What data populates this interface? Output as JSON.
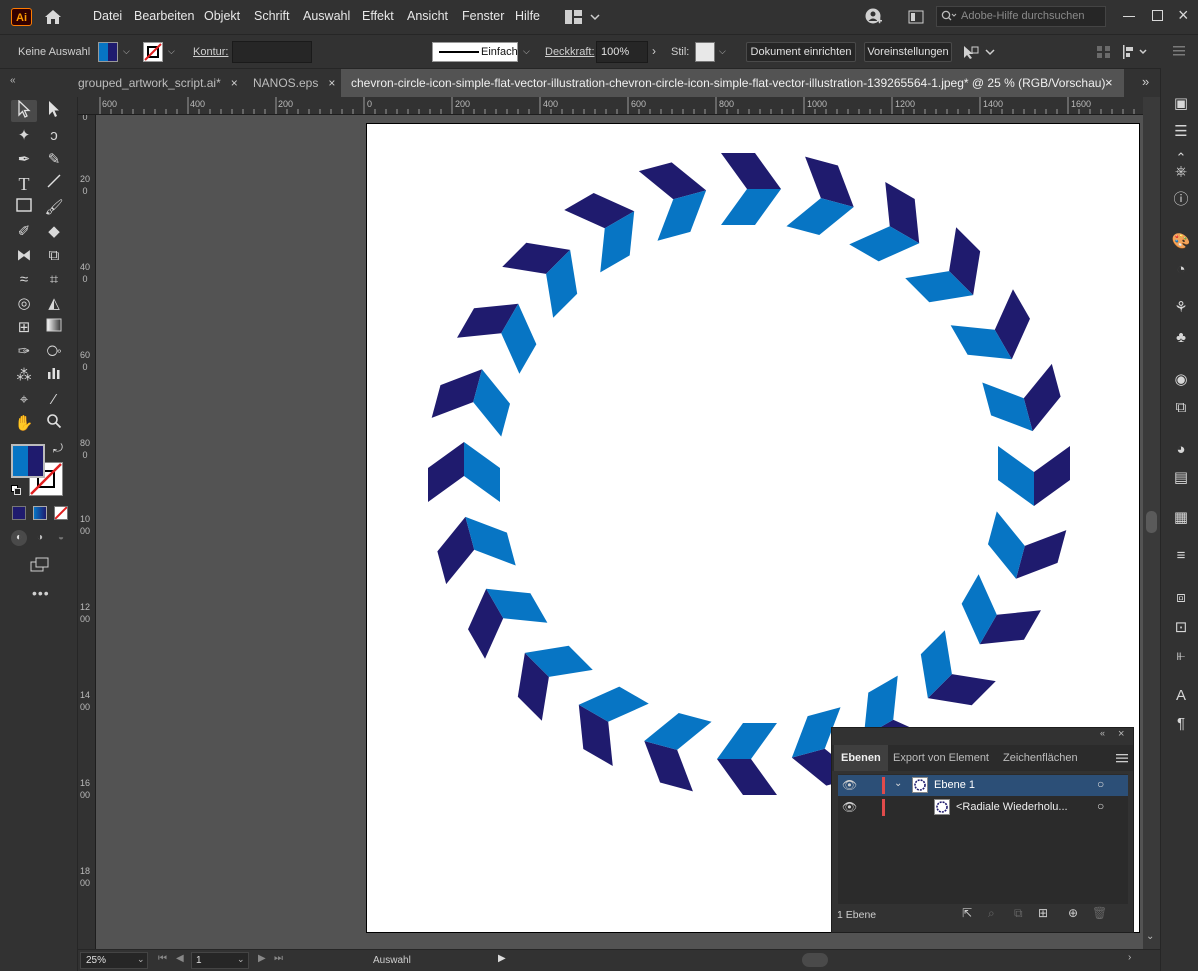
{
  "app": {
    "logo": "Ai",
    "menu": [
      "Datei",
      "Bearbeiten",
      "Objekt",
      "Schrift",
      "Auswahl",
      "Effekt",
      "Ansicht",
      "Fenster",
      "Hilfe"
    ],
    "help_placeholder": "Adobe-Hilfe durchsuchen"
  },
  "control": {
    "selection_state": "Keine Auswahl",
    "stroke_label": "Kontur:",
    "stroke_style": "Einfach",
    "opacity_label": "Deckkraft:",
    "opacity_value": "100%",
    "style_label": "Stil:",
    "doc_setup_button": "Dokument einrichten",
    "preferences_button": "Voreinstellungen"
  },
  "tabs": [
    {
      "label": "grouped_artwork_script.ai*",
      "active": false
    },
    {
      "label": "NANOS.eps",
      "active": false
    },
    {
      "label": "chevron-circle-icon-simple-flat-vector-illustration-chevron-circle-icon-simple-flat-vector-illustration-139265564-1.jpeg* @ 25 % (RGB/Vorschau)",
      "active": true
    }
  ],
  "ruler_top": [
    "600",
    "400",
    "200",
    "0",
    "200",
    "400",
    "600",
    "800",
    "1000",
    "1200",
    "1400",
    "1600"
  ],
  "ruler_left": [
    "0",
    "200",
    "400",
    "600",
    "800",
    "1000",
    "1200",
    "1400",
    "1600",
    "1800"
  ],
  "artwork": {
    "chevron_count": 24,
    "dark_color": "#1f1b6e",
    "light_color": "#0775c4"
  },
  "colors": {
    "fill": "#1f1b6e",
    "fill_gradient_light": "#0775c4",
    "stroke_none_marker": "#e02020"
  },
  "layers_panel": {
    "tabs": [
      "Ebenen",
      "Export von Element",
      "Zeichenflächen"
    ],
    "rows": [
      {
        "name": "Ebene 1",
        "level": 0
      },
      {
        "name": "<Radiale Wiederholu...",
        "level": 1
      }
    ],
    "footer_count": "1 Ebene"
  },
  "status": {
    "zoom": "25%",
    "artboard_number": "1",
    "tool_name": "Auswahl"
  }
}
